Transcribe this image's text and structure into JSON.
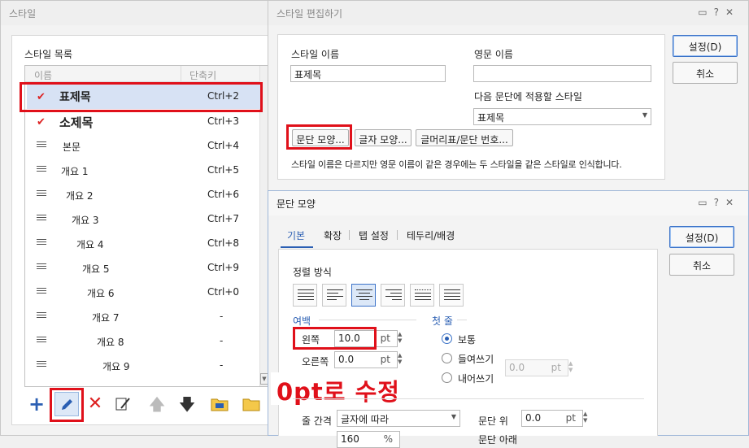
{
  "style_window": {
    "title": "스타일",
    "list_label": "스타일 목록",
    "col_name": "이름",
    "col_shortcut": "단축키",
    "items": [
      {
        "name": "표제목",
        "key": "Ctrl+2"
      },
      {
        "name": "소제목",
        "key": "Ctrl+3"
      },
      {
        "name": "본문",
        "key": "Ctrl+4"
      },
      {
        "name": "개요 1",
        "key": "Ctrl+5"
      },
      {
        "name": "개요 2",
        "key": "Ctrl+6"
      },
      {
        "name": "개요 3",
        "key": "Ctrl+7"
      },
      {
        "name": "개요 4",
        "key": "Ctrl+8"
      },
      {
        "name": "개요 5",
        "key": "Ctrl+9"
      },
      {
        "name": "개요 6",
        "key": "Ctrl+0"
      },
      {
        "name": "개요 7",
        "key": "-"
      },
      {
        "name": "개요 8",
        "key": "-"
      },
      {
        "name": "개요 9",
        "key": "-"
      }
    ],
    "toolbar_icons": [
      "plus-icon",
      "pencil-icon",
      "delete-x-icon",
      "eyedropper-icon",
      "arrow-up-icon",
      "arrow-down-icon",
      "style-folder-icon",
      "open-folder-icon"
    ]
  },
  "edit_window": {
    "title": "스타일 편집하기",
    "style_name_label": "스타일 이름",
    "style_name_value": "표제목",
    "eng_name_label": "영문 이름",
    "eng_name_value": "",
    "next_style_label": "다음 문단에 적용할 스타일",
    "next_style_value": "표제목",
    "para_btn": "문단 모양...",
    "char_btn": "글자 모양...",
    "bullet_btn": "글머리표/문단 번호...",
    "note": "스타일 이름은 다르지만 영문 이름이 같은 경우에는 두 스타일을 같은 스타일로 인식합니다.",
    "ok_btn": "설정(D)",
    "cancel_btn": "취소"
  },
  "para_window": {
    "title": "문단 모양",
    "tabs": [
      "기본",
      "확장",
      "탭 설정",
      "테두리/배경"
    ],
    "ok_btn": "설정(D)",
    "cancel_btn": "취소",
    "align_label": "정렬 방식",
    "margin_label": "여백",
    "left_label": "왼쪽",
    "left_value": "10.0",
    "right_label": "오른쪽",
    "right_value": "0.0",
    "unit": "pt",
    "first_line_label": "첫 줄",
    "radio_normal": "보통",
    "radio_indent": "들여쓰기",
    "radio_outdent": "내어쓰기",
    "indent_value": "0.0",
    "line_spacing_label": "줄 간격",
    "line_spacing_value": "글자에 따라",
    "para_above_label": "문단 위",
    "para_above_value": "0.0",
    "para_below_label": "문단 아래",
    "line_value": "160",
    "line_unit": "%"
  },
  "annotation": {
    "text": "0pt로 수정",
    "color": "#e0101a"
  }
}
